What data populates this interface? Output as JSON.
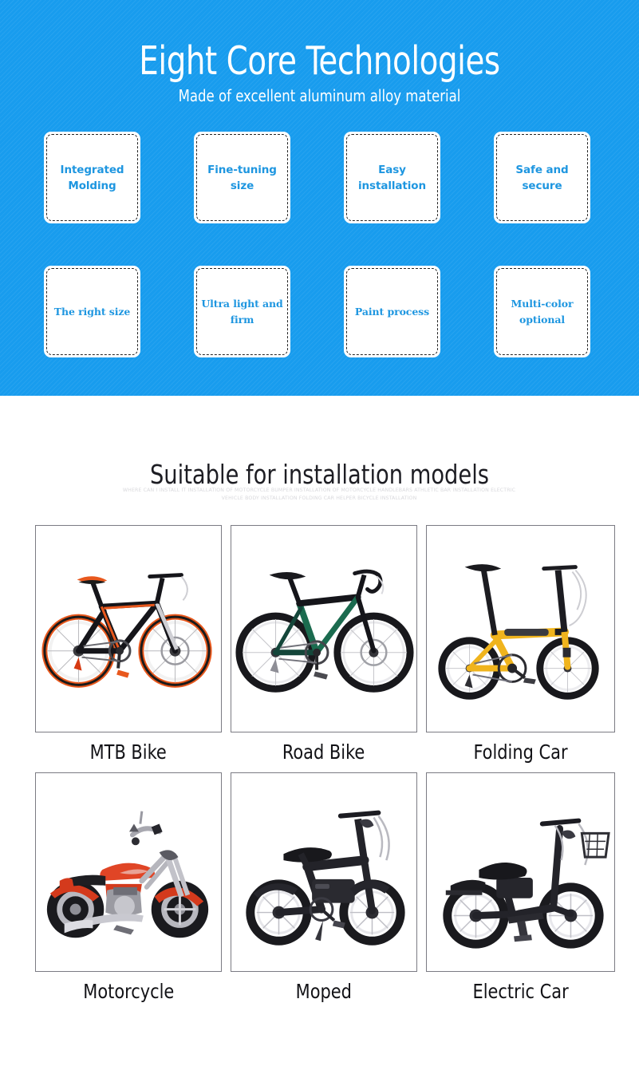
{
  "hero": {
    "title": "Eight Core Technologies",
    "subtitle": "Made of excellent aluminum alloy material",
    "background_color": "#189CEE",
    "text_color": "#ffffff",
    "features": [
      {
        "label": "Integrated Molding",
        "style": "sans"
      },
      {
        "label": "Fine-tuning size",
        "style": "sans"
      },
      {
        "label": "Easy installation",
        "style": "sans"
      },
      {
        "label": "Safe and secure",
        "style": "sans"
      },
      {
        "label": "The right size",
        "style": "serif"
      },
      {
        "label": "Ultra light and firm",
        "style": "serif"
      },
      {
        "label": "Paint process",
        "style": "serif"
      },
      {
        "label": "Multi-color optional",
        "style": "serif"
      }
    ],
    "feature_text_color": "#1E96E0",
    "feature_box_color": "#ffffff"
  },
  "models": {
    "title": "Suitable for installation models",
    "keywords": "WHERE CAN I INSTALL IT INSTALLATION OF MOTORCYCLE BUMPER INSTALLATION OF MOTORCYCLE HANDLEBARS ATHLETIC BAR INSTALLATION ELECTRIC VEHICLE BODY INSTALLATION FOLDING CAR HELPER BICYCLE INSTALLATION",
    "keywords_color": "#d8d8dc",
    "cards": [
      {
        "label": "MTB Bike",
        "image": "mtb-bike-photo"
      },
      {
        "label": "Road Bike",
        "image": "road-bike-photo"
      },
      {
        "label": "Folding Car",
        "image": "folding-bike-photo"
      },
      {
        "label": "Motorcycle",
        "image": "motorcycle-photo"
      },
      {
        "label": "Moped",
        "image": "moped-photo"
      },
      {
        "label": "Electric Car",
        "image": "electric-scooter-photo"
      }
    ]
  }
}
